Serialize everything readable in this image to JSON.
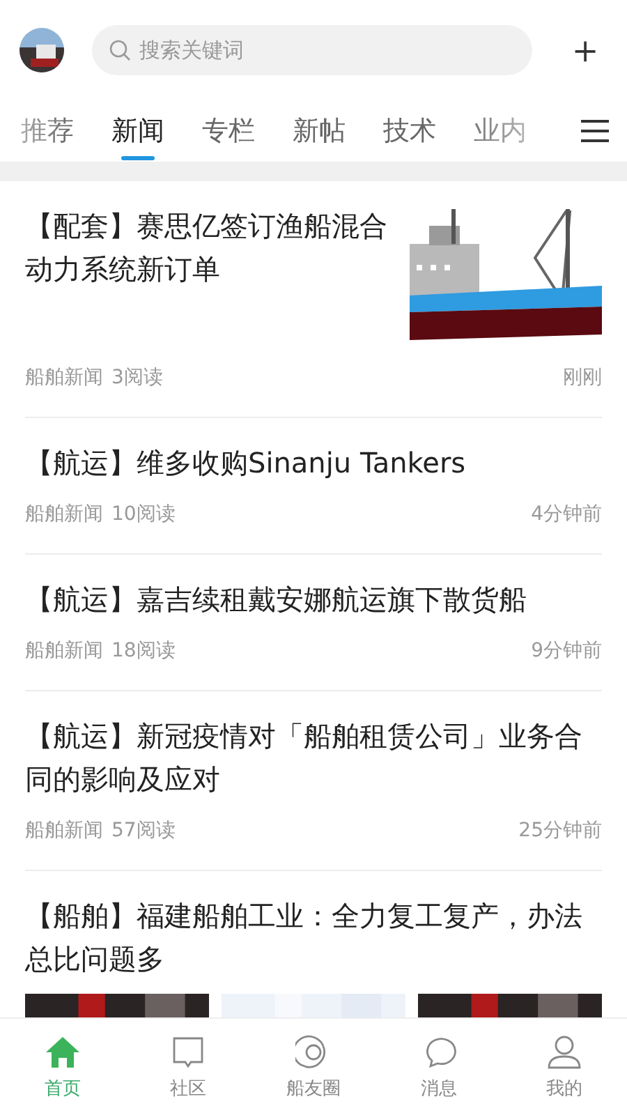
{
  "header": {
    "search": {
      "placeholder": "搜索关键词"
    },
    "add_icon": "＋"
  },
  "tabs": [
    {
      "label": "推荐",
      "selected": false
    },
    {
      "label": "新闻",
      "selected": true
    },
    {
      "label": "专栏",
      "selected": false
    },
    {
      "label": "新帖",
      "selected": false
    },
    {
      "label": "技术",
      "selected": false
    },
    {
      "label": "业内",
      "selected": false
    }
  ],
  "articles": [
    {
      "title": "【配套】赛思亿签订渔船混合动力系统新订单",
      "source": "船舶新闻",
      "reads": "3阅读",
      "time": "刚刚"
    },
    {
      "title": "【航运】维多收购Sinanju Tankers",
      "source": "船舶新闻",
      "reads": "10阅读",
      "time": "4分钟前"
    },
    {
      "title": "【航运】嘉吉续租戴安娜航运旗下散货船",
      "source": "船舶新闻",
      "reads": "18阅读",
      "time": "9分钟前"
    },
    {
      "title": "【航运】新冠疫情对「船舶租赁公司」业务合同的影响及应对",
      "source": "船舶新闻",
      "reads": "57阅读",
      "time": "25分钟前"
    },
    {
      "title": "【船舶】福建船舶工业：全力复工复产，办法总比问题多"
    }
  ],
  "bottom_nav": [
    {
      "label": "首页",
      "kind": "home",
      "selected": true
    },
    {
      "label": "社区",
      "kind": "community",
      "selected": false
    },
    {
      "label": "船友圈",
      "kind": "circle",
      "selected": false
    },
    {
      "label": "消息",
      "kind": "message",
      "selected": false
    },
    {
      "label": "我的",
      "kind": "profile",
      "selected": false
    }
  ]
}
